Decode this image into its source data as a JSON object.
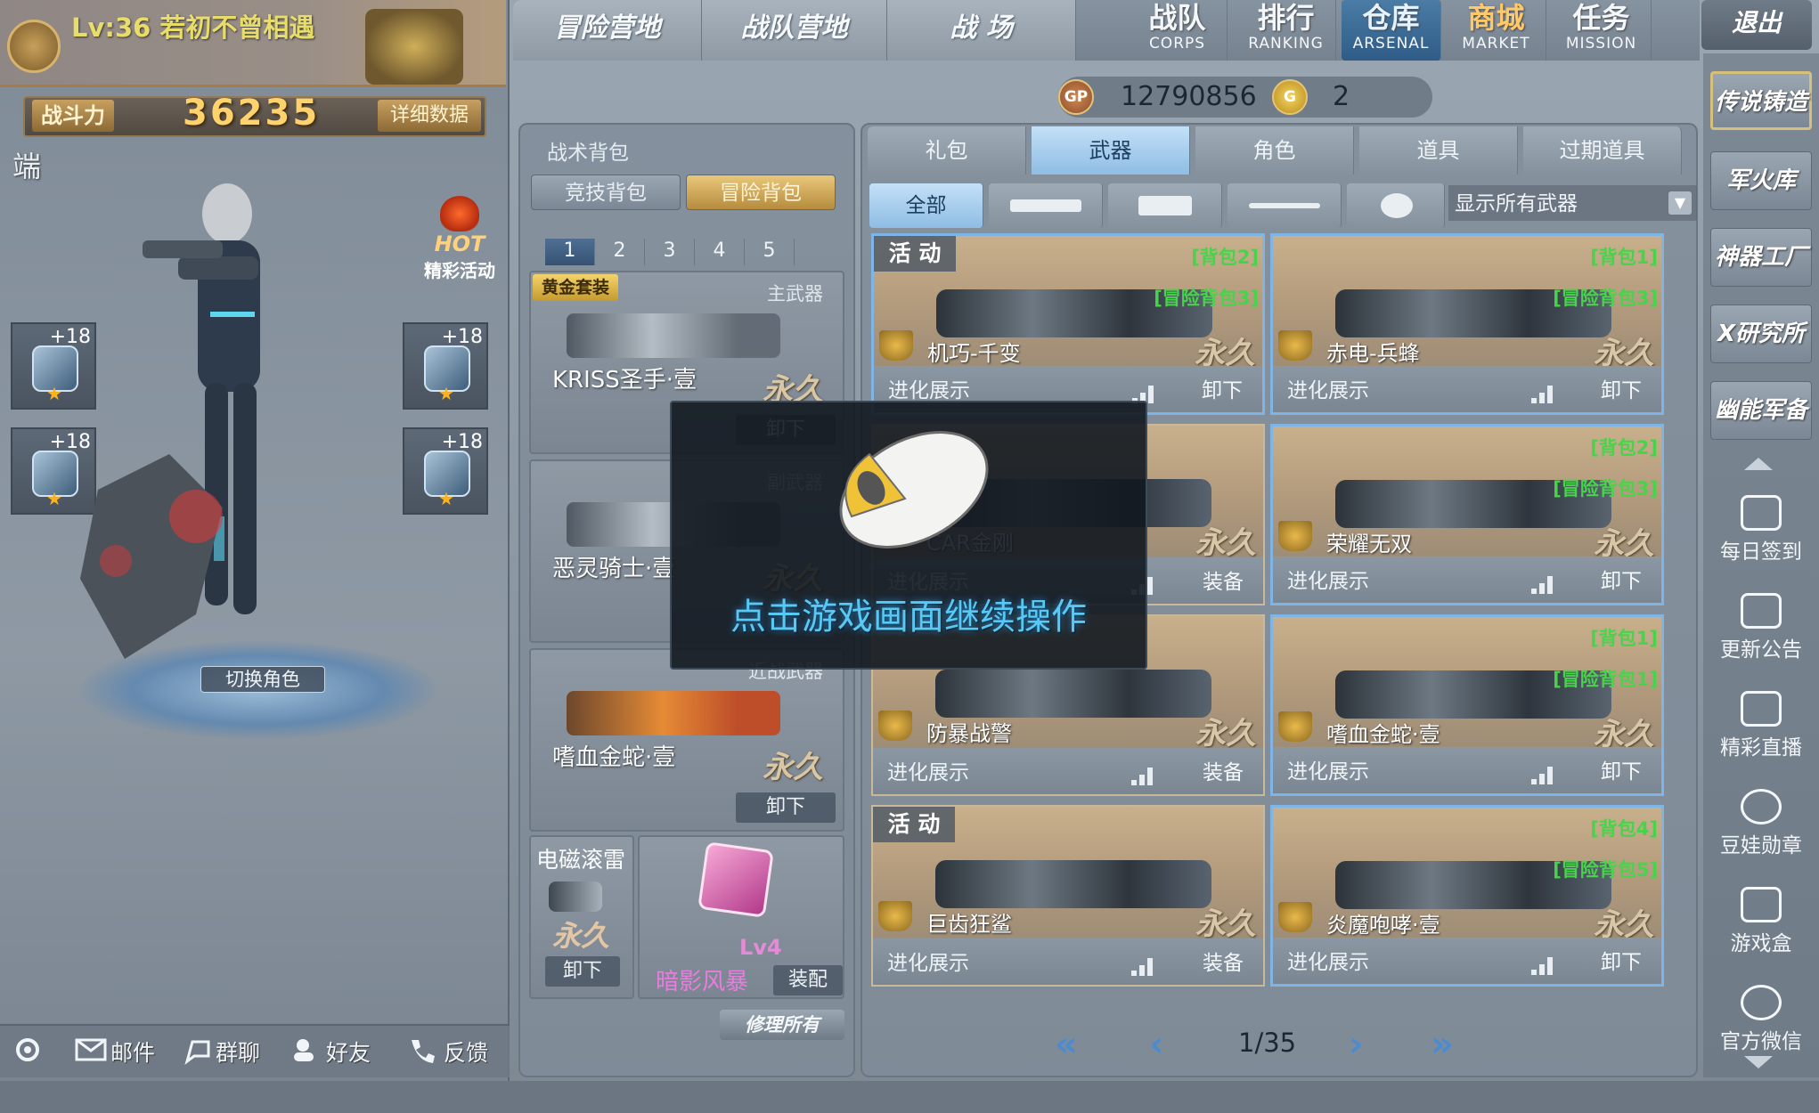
{
  "profile": {
    "level_name": "Lv:36 若初不曾相遇",
    "power_label": "战斗力",
    "power_value": "36235",
    "detail_button": "详细数据",
    "client_label": "端"
  },
  "hot_event": {
    "hot": "HOT",
    "label": "精彩活动"
  },
  "equipment_slots": [
    {
      "plus": "+18"
    },
    {
      "plus": "+18"
    },
    {
      "plus": "+18"
    },
    {
      "plus": "+18"
    }
  ],
  "switch_role": "切换角色",
  "bottom_bar": {
    "mail": "邮件",
    "group_chat": "群聊",
    "friends": "好友",
    "feedback": "反馈"
  },
  "top_nav": {
    "tabs": [
      "冒险营地",
      "战队营地",
      "战 场"
    ],
    "right": [
      {
        "cn": "战队",
        "en": "CORPS"
      },
      {
        "cn": "排行",
        "en": "RANKING"
      },
      {
        "cn": "仓库",
        "en": "ARSENAL"
      },
      {
        "cn": "商城",
        "en": "MARKET"
      },
      {
        "cn": "任务",
        "en": "MISSION"
      }
    ],
    "exit": "退出"
  },
  "currency": {
    "gp_icon": "GP",
    "gp_value": "12790856",
    "g_icon": "G",
    "g_value": "2"
  },
  "backpack": {
    "title": "战术背包",
    "tabs": [
      "竞技背包",
      "冒险背包"
    ],
    "active_tab": 1,
    "numbers": [
      "1",
      "2",
      "3",
      "4",
      "5"
    ],
    "active_number": 0,
    "primary": {
      "badge": "黄金套装",
      "type": "主武器",
      "name": "KRISS圣手·壹",
      "perm": "永久",
      "button": "卸下"
    },
    "secondary": {
      "type": "副武器",
      "name": "恶灵骑士·壹",
      "perm": "永久"
    },
    "melee": {
      "type": "近战武器",
      "name": "嗜血金蛇·壹",
      "perm": "永久",
      "button": "卸下"
    },
    "grenade": {
      "name": "电磁滚雷",
      "perm": "永久",
      "button": "卸下"
    },
    "storm": {
      "level": "Lv4",
      "name": "暗影风暴",
      "button": "装配"
    },
    "repair": "修理所有"
  },
  "main_tabs": [
    "礼包",
    "武器",
    "角色",
    "道具",
    "过期道具"
  ],
  "active_main_tab": 1,
  "filter": {
    "all": "全部",
    "show_all": "显示所有武器"
  },
  "cards": [
    {
      "tag": "活 动",
      "b1": "[背包2]",
      "b2": "[冒险背包3]",
      "name": "机巧-千变",
      "perm": "永久",
      "evo": "进化展示",
      "action": "卸下",
      "selected": true
    },
    {
      "tag": "",
      "b1": "[背包1]",
      "b2": "[冒险背包3]",
      "name": "赤电-兵蜂",
      "perm": "永久",
      "evo": "进化展示",
      "action": "卸下",
      "selected": true
    },
    {
      "tag": "",
      "b1": "",
      "b2": "",
      "name": "CAR金刚",
      "perm": "永久",
      "evo": "进化展示",
      "action": "装备",
      "selected": false
    },
    {
      "tag": "",
      "b1": "[背包2]",
      "b2": "[冒险背包3]",
      "name": "荣耀无双",
      "perm": "永久",
      "evo": "进化展示",
      "action": "卸下",
      "selected": true
    },
    {
      "tag": "",
      "b1": "",
      "b2": "",
      "name": "防暴战警",
      "perm": "永久",
      "evo": "进化展示",
      "action": "装备",
      "selected": false
    },
    {
      "tag": "",
      "b1": "[背包1]",
      "b2": "[冒险背包1]",
      "name": "嗜血金蛇·壹",
      "perm": "永久",
      "evo": "进化展示",
      "action": "卸下",
      "selected": true
    },
    {
      "tag": "活 动",
      "b1": "",
      "b2": "",
      "name": "巨齿狂鲨",
      "perm": "永久",
      "evo": "进化展示",
      "action": "装备",
      "selected": false
    },
    {
      "tag": "",
      "b1": "[背包4]",
      "b2": "[冒险背包5]",
      "name": "炎魔咆哮·壹",
      "perm": "永久",
      "evo": "进化展示",
      "action": "卸下",
      "selected": true
    }
  ],
  "pager": {
    "page": "1/35"
  },
  "right_side": {
    "buttons": [
      "传说铸造",
      "军火库",
      "神器工厂",
      "X研究所",
      "幽能军备"
    ],
    "icons": [
      "每日签到",
      "更新公告",
      "精彩直播",
      "豆娃勋章",
      "游戏盒",
      "官方微信"
    ]
  },
  "overlay": {
    "text": "点击游戏画面继续操作"
  }
}
